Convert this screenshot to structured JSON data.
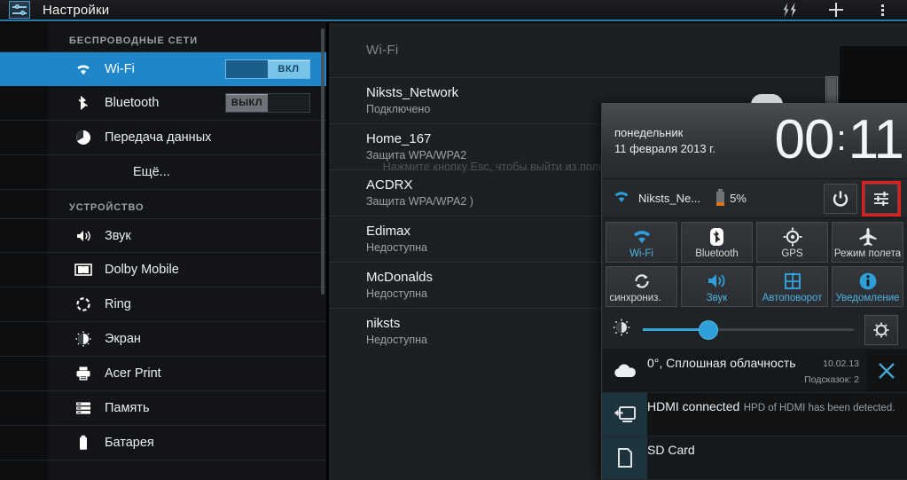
{
  "actionbar": {
    "title": "Настройки",
    "app_icon": "settings-sliders-icon",
    "buttons": [
      {
        "name": "wifi-direct-flash-icon",
        "label": ""
      },
      {
        "name": "add-icon",
        "label": ""
      },
      {
        "name": "overflow-menu-icon",
        "label": ""
      }
    ]
  },
  "sidebar": {
    "sections": [
      {
        "header": "БЕСПРОВОДНЫЕ СЕТИ",
        "items": [
          {
            "label": "Wi-Fi",
            "icon": "wifi-icon",
            "selected": true,
            "toggle": "on",
            "toggle_on_label": "ВКЛ",
            "toggle_off_label": "ВЫКЛ"
          },
          {
            "label": "Bluetooth",
            "icon": "bluetooth-icon",
            "selected": false,
            "toggle": "off",
            "toggle_on_label": "ВКЛ",
            "toggle_off_label": "ВЫКЛ"
          },
          {
            "label": "Передача данных",
            "icon": "data-usage-icon",
            "selected": false,
            "toggle": "none"
          },
          {
            "label": "Ещё...",
            "icon": "none",
            "selected": false,
            "toggle": "none"
          }
        ]
      },
      {
        "header": "УСТРОЙСТВО",
        "items": [
          {
            "label": "Звук",
            "icon": "volume-icon",
            "selected": false,
            "toggle": "none"
          },
          {
            "label": "Dolby Mobile",
            "icon": "dolby-icon",
            "selected": false,
            "toggle": "none"
          },
          {
            "label": "Ring",
            "icon": "ring-icon",
            "selected": false,
            "toggle": "none"
          },
          {
            "label": "Экран",
            "icon": "brightness-icon",
            "selected": false,
            "toggle": "none"
          },
          {
            "label": "Acer Print",
            "icon": "printer-icon",
            "selected": false,
            "toggle": "none"
          },
          {
            "label": "Память",
            "icon": "storage-icon",
            "selected": false,
            "toggle": "none"
          },
          {
            "label": "Батарея",
            "icon": "battery-icon",
            "selected": false,
            "toggle": "none"
          }
        ]
      }
    ]
  },
  "wifi": {
    "title": "Wi-Fi",
    "networks": [
      {
        "name": "Niksts_Network",
        "status": "Подключено"
      },
      {
        "name": "Home_167",
        "status": "Защита WPA/WPA2"
      },
      {
        "name": "ACDRX",
        "status": "Защита WPA/WPA2 )"
      },
      {
        "name": "Edimax",
        "status": "Недоступна"
      },
      {
        "name": "McDonalds",
        "status": "Недоступна"
      },
      {
        "name": "niksts",
        "status": "Недоступна"
      }
    ]
  },
  "fullscreen_hint": "Нажмите кнопку Esc, чтобы выйти из полноэкранного режима.",
  "panel": {
    "clock": {
      "weekday": "понедельник",
      "date": "11 февраля 2013 г.",
      "hours": "00",
      "separator": ":",
      "minutes": "11"
    },
    "status": {
      "wifi_icon": "wifi-icon",
      "ssid": "Niksts_Ne...",
      "battery_icon": "battery-icon",
      "battery_percent": "5%",
      "battery_level": 5,
      "power_button": "power-icon",
      "settings_button": "quick-settings-sliders-icon"
    },
    "tiles": [
      {
        "label": "Wi-Fi",
        "icon": "wifi-icon",
        "active": true,
        "clipped": false
      },
      {
        "label": "Bluetooth",
        "icon": "bluetooth-icon",
        "active": false,
        "clipped": false
      },
      {
        "label": "GPS",
        "icon": "gps-icon",
        "active": false,
        "clipped": false
      },
      {
        "label": "Режим полета",
        "icon": "airplane-icon",
        "active": false,
        "clipped": false
      },
      {
        "label": "синхрониз.",
        "icon": "sync-icon",
        "active": false,
        "clipped": true
      },
      {
        "label": "Звук",
        "icon": "volume-icon",
        "active": true,
        "clipped": false
      },
      {
        "label": "Автоповорот",
        "icon": "autorotate-icon",
        "active": true,
        "clipped": false
      },
      {
        "label": "Уведомление",
        "icon": "info-icon",
        "active": true,
        "clipped": false
      }
    ],
    "brightness": {
      "icon": "brightness-icon",
      "value": 31,
      "auto_icon": "auto-brightness-gear-icon"
    },
    "notifications": [
      {
        "icon": "cloud-icon",
        "title": "0°, Сплошная облачность",
        "subtitle": "",
        "time": "10.02.13",
        "count": "Подсказок: 2",
        "close": "close-icon",
        "kind": "weather"
      },
      {
        "icon": "hdmi-display-icon",
        "title": "HDMI connected",
        "subtitle": "HPD of HDMI has been detected.",
        "time": "",
        "count": "",
        "close": "",
        "kind": "hdmi"
      },
      {
        "icon": "sdcard-icon",
        "title": "SD Card",
        "subtitle": "",
        "time": "",
        "count": "",
        "close": "",
        "kind": "sdcard"
      }
    ]
  },
  "colors": {
    "accent": "#1e86c9",
    "tile_active": "#4fb3e0",
    "battery_warn": "#e2711d",
    "highlight_outline": "#e71b18"
  }
}
